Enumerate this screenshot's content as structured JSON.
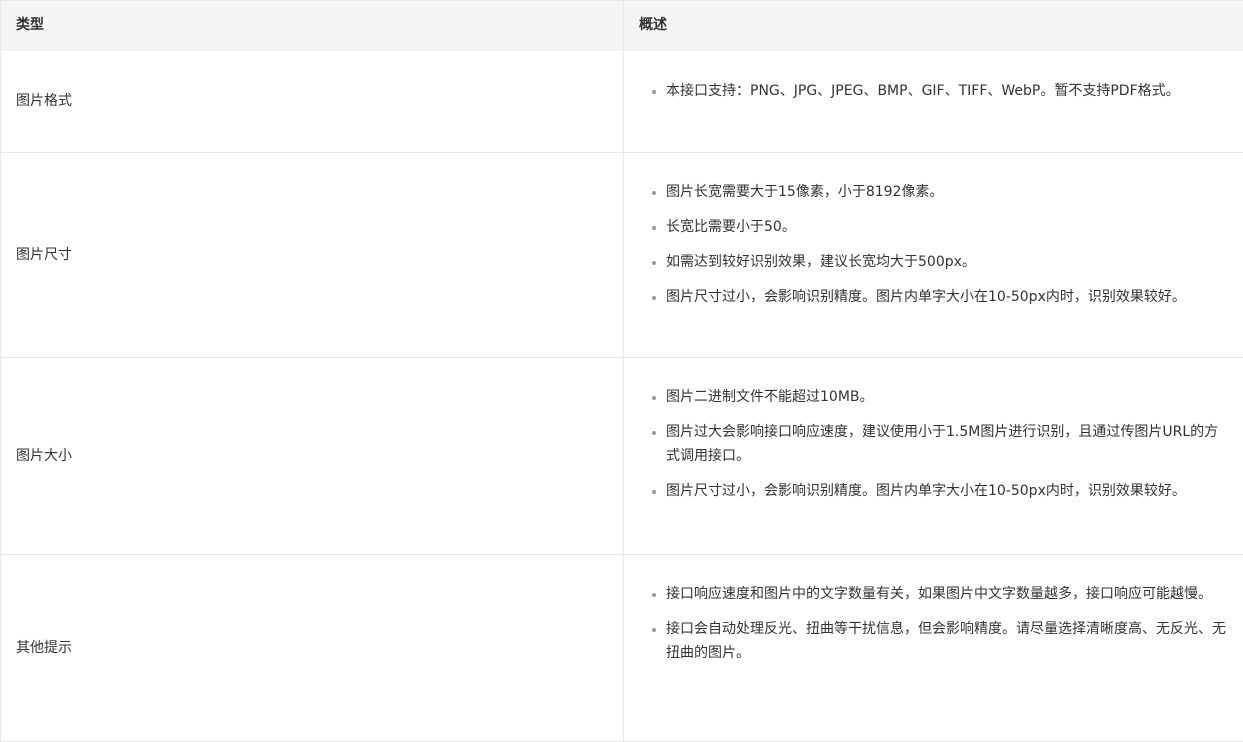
{
  "table": {
    "headers": {
      "type": "类型",
      "description": "概述"
    },
    "rows": [
      {
        "type": "图片格式",
        "items": [
          "本接口支持：PNG、JPG、JPEG、BMP、GIF、TIFF、WebP。暂不支持PDF格式。"
        ]
      },
      {
        "type": "图片尺寸",
        "items": [
          "图片长宽需要大于15像素，小于8192像素。",
          "长宽比需要小于50。",
          "如需达到较好识别效果，建议长宽均大于500px。",
          "图片尺寸过小，会影响识别精度。图片内单字大小在10-50px内时，识别效果较好。"
        ]
      },
      {
        "type": "图片大小",
        "items": [
          "图片二进制文件不能超过10MB。",
          "图片过大会影响接口响应速度，建议使用小于1.5M图片进行识别，且通过传图片URL的方式调用接口。",
          "图片尺寸过小，会影响识别精度。图片内单字大小在10-50px内时，识别效果较好。"
        ]
      },
      {
        "type": "其他提示",
        "items": [
          "接口响应速度和图片中的文字数量有关，如果图片中文字数量越多，接口响应可能越慢。",
          "接口会自动处理反光、扭曲等干扰信息，但会影响精度。请尽量选择清晰度高、无反光、无扭曲的图片。"
        ]
      }
    ]
  }
}
